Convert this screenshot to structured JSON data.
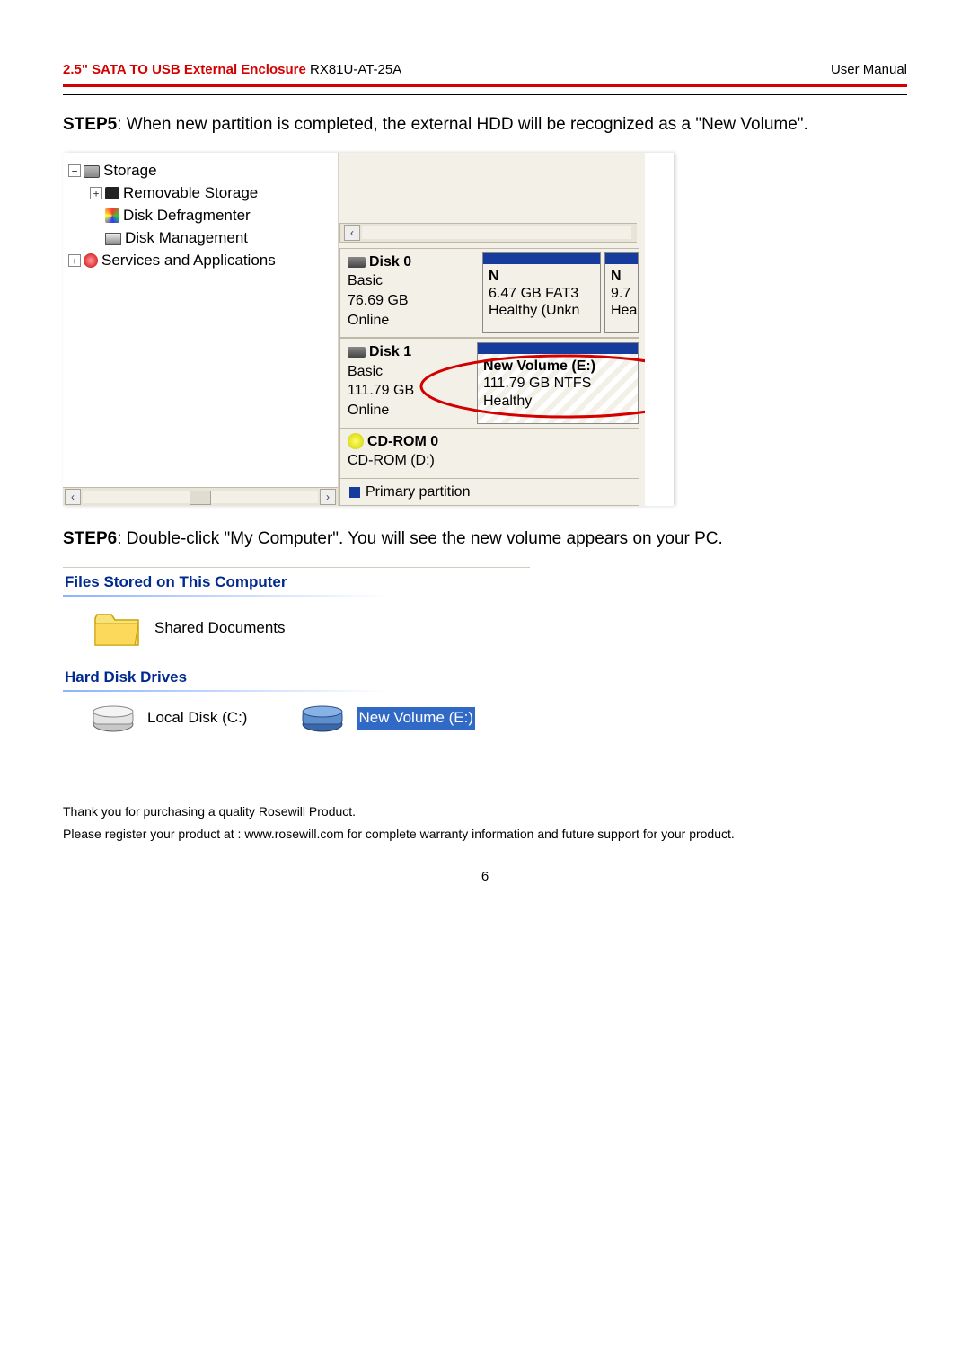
{
  "header": {
    "product_left": "2.5\" SATA TO USB External Enclosure",
    "model": "RX81U-AT-25A",
    "right": "User Manual"
  },
  "step5": {
    "bold": "STEP5",
    "text": ": When new partition is completed, the external HDD will be recognized as a \"New Volume\"."
  },
  "tree": {
    "storage": "Storage",
    "removable": "Removable Storage",
    "defrag": "Disk Defragmenter",
    "dmgmt": "Disk Management",
    "services": "Services and Applications"
  },
  "disks": {
    "d0": {
      "name": "Disk 0",
      "type": "Basic",
      "size": "76.69 GB",
      "status": "Online"
    },
    "p0a": {
      "n": "N",
      "sz": "6.47 GB FAT3",
      "st": "Healthy (Unkn"
    },
    "p0b": {
      "n": "N",
      "sz": "9.7",
      "st": "Hea"
    },
    "d1": {
      "name": "Disk 1",
      "type": "Basic",
      "size": "111.79 GB",
      "status": "Online"
    },
    "p1": {
      "n": "New Volume (E:)",
      "sz": "111.79 GB NTFS",
      "st": "Healthy"
    },
    "cd": {
      "name": "CD-ROM 0",
      "sub": "CD-ROM (D:)"
    },
    "legend": "Primary partition"
  },
  "step6": {
    "bold": "STEP6",
    "text": ": Double-click \"My Computer\".  You will see the new volume appears on your PC."
  },
  "mycomp": {
    "sec1": "Files Stored on This Computer",
    "shared": "Shared Documents",
    "sec2": "Hard Disk Drives",
    "local": "Local Disk (C:)",
    "newvol": "New Volume (E:)"
  },
  "footer": {
    "l1": "Thank you for purchasing a quality Rosewill Product.",
    "l2": "Please register your product at : www.rosewill.com for complete warranty information and future support for your product.",
    "page": "6"
  }
}
